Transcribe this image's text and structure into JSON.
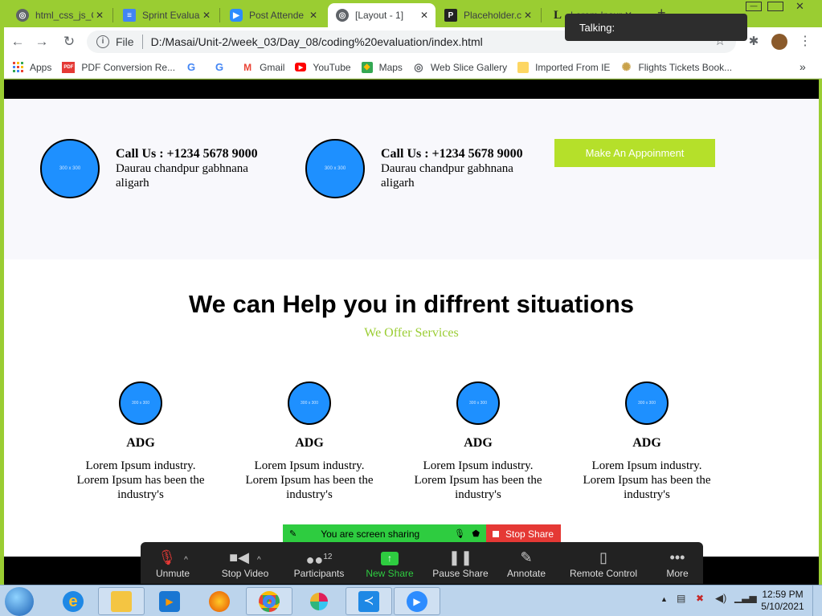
{
  "tabs": [
    {
      "label": "html_css_js_C",
      "icon": "globe-icon",
      "close": "✕"
    },
    {
      "label": "Sprint Evalua",
      "icon": "docs-icon",
      "close": "✕"
    },
    {
      "label": "Post Attende",
      "icon": "zoom-icon",
      "close": "✕"
    },
    {
      "label": "[Layout - 1]",
      "icon": "globe-icon",
      "close": "✕"
    },
    {
      "label": "Placeholder.c",
      "icon": "placeholder-p-icon",
      "close": "✕"
    },
    {
      "label": "Lorem Ipsum",
      "icon": "lorem-l-icon",
      "close": "✕"
    }
  ],
  "toolbar": {
    "file_label": "File",
    "url": "D:/Masai/Unit-2/week_03/Day_08/coding%20evaluation/index.html"
  },
  "bookmarks": [
    {
      "label": "Apps",
      "icon": "apps-grid-icon"
    },
    {
      "label": "PDF Conversion Re...",
      "icon": "pdf-icon"
    },
    {
      "label": "",
      "icon": "google-icon"
    },
    {
      "label": "",
      "icon": "google-icon"
    },
    {
      "label": "Gmail",
      "icon": "gmail-icon"
    },
    {
      "label": "YouTube",
      "icon": "youtube-icon"
    },
    {
      "label": "Maps",
      "icon": "maps-icon"
    },
    {
      "label": "Web Slice Gallery",
      "icon": "globe-icon"
    },
    {
      "label": "Imported From IE",
      "icon": "folder-icon"
    },
    {
      "label": "Flights Tickets Book...",
      "icon": "gear-icon"
    }
  ],
  "bookmarks_more": "»",
  "talking_label": "Talking:",
  "contact": {
    "placeholder": "300 x 300",
    "items": [
      {
        "call": "Call Us : +1234 5678 9000",
        "address": "Daurau chandpur gabhnana aligarh"
      },
      {
        "call": "Call Us : +1234 5678 9000",
        "address": "Daurau chandpur gabhnana aligarh"
      }
    ],
    "button": "Make An Appoinment"
  },
  "services": {
    "title": "We can Help you in diffrent situations",
    "subtitle": "We Offer Services",
    "placeholder": "300 x 300",
    "cards": [
      {
        "title": "ADG",
        "text": "Lorem Ipsum industry. Lorem Ipsum has been the industry's"
      },
      {
        "title": "ADG",
        "text": "Lorem Ipsum industry. Lorem Ipsum has been the industry's"
      },
      {
        "title": "ADG",
        "text": "Lorem Ipsum industry. Lorem Ipsum has been the industry's"
      },
      {
        "title": "ADG",
        "text": "Lorem Ipsum industry. Lorem Ipsum has been the industry's"
      }
    ]
  },
  "zoom": {
    "sharing_label": "You are screen sharing",
    "stop_share": "Stop Share",
    "participant_count": "12",
    "buttons": [
      "Unmute",
      "Stop Video",
      "Participants",
      "New Share",
      "Pause Share",
      "Annotate",
      "Remote Control",
      "More"
    ]
  },
  "taskbar": {
    "time": "12:59 PM",
    "date": "5/10/2021"
  }
}
